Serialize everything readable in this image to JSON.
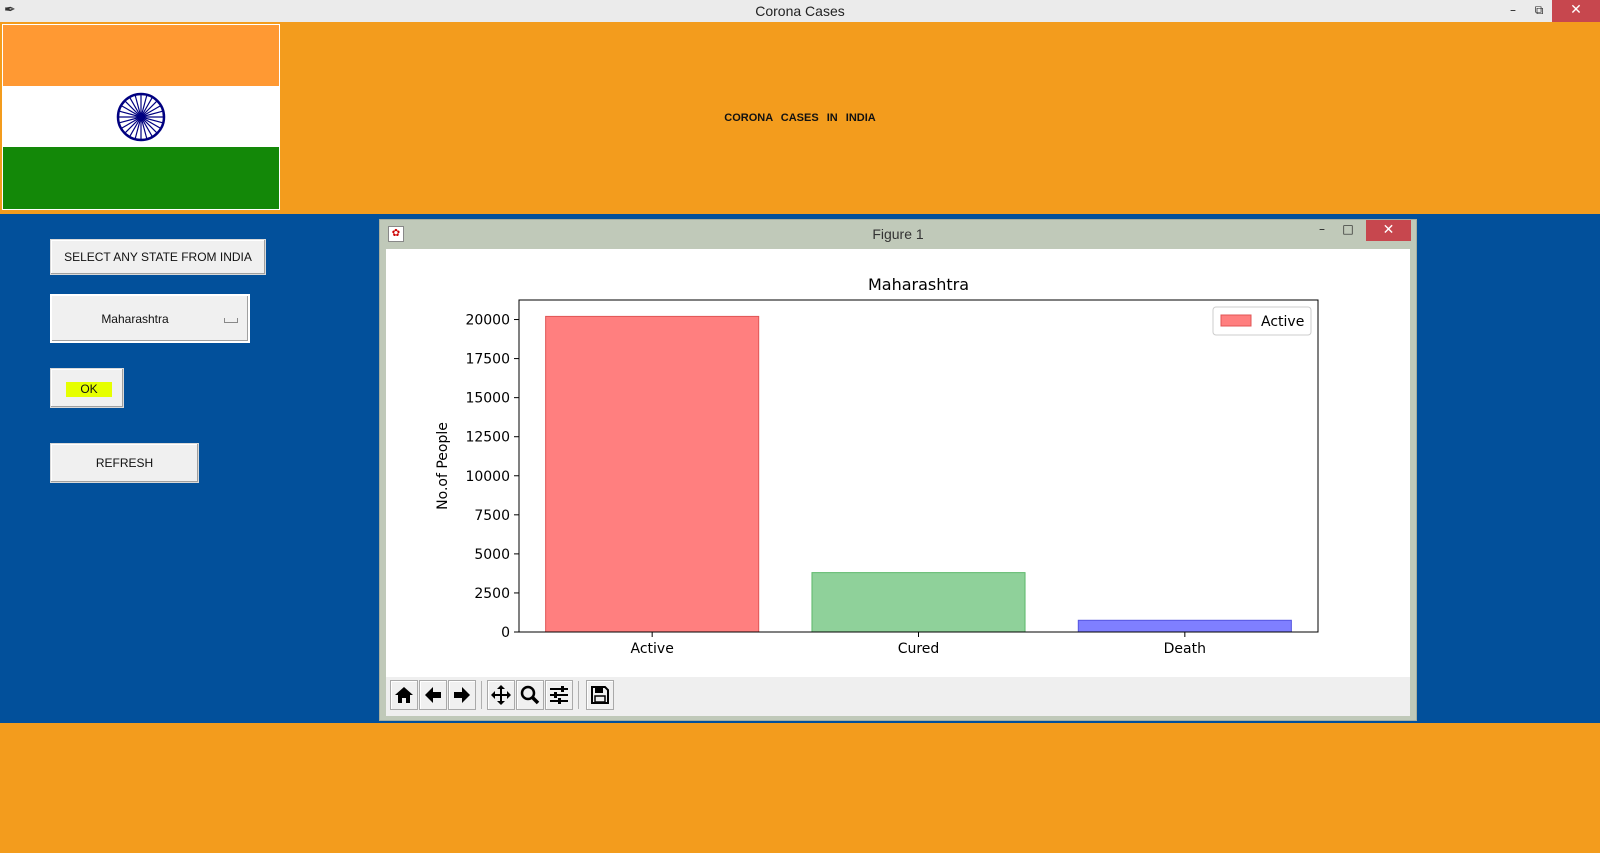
{
  "window": {
    "title": "Corona Cases"
  },
  "header": {
    "title": "CORONA   CASES   IN   INDIA"
  },
  "controls": {
    "select_label": "SELECT ANY STATE FROM INDIA",
    "selected_state": "Maharashtra",
    "ok_label": "OK",
    "refresh_label": "REFRESH"
  },
  "figure": {
    "title": "Figure 1"
  },
  "toolbar": {
    "icons": [
      "home-icon",
      "back-arrow-icon",
      "forward-arrow-icon",
      "pan-icon",
      "zoom-icon",
      "configure-subplots-icon",
      "save-icon"
    ]
  },
  "colors": {
    "accent": "#f39c1d",
    "band": "#02509b",
    "active": "#ff7f7f",
    "cured": "#8fd19a",
    "death": "#7f7fff"
  },
  "chart_data": {
    "type": "bar",
    "title": "Maharashtra",
    "xlabel": "",
    "ylabel": "No.of People",
    "categories": [
      "Active",
      "Cured",
      "Death"
    ],
    "values": [
      20200,
      3800,
      750
    ],
    "colors": [
      "#ff7f7f",
      "#8fd19a",
      "#7f7fff"
    ],
    "edge_colors": [
      "#e05555",
      "#5cb86a",
      "#5555e0"
    ],
    "yticks": [
      0,
      2500,
      5000,
      7500,
      10000,
      12500,
      15000,
      17500,
      20000
    ],
    "ylim": [
      0,
      21250
    ],
    "legend": {
      "entries": [
        "Active"
      ],
      "position": "upper right"
    },
    "grid": false
  }
}
